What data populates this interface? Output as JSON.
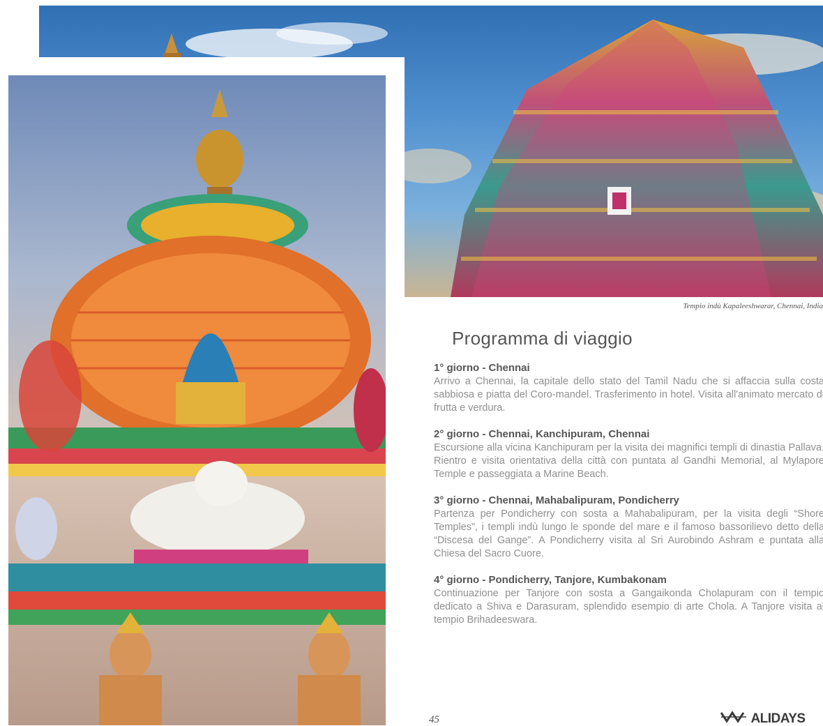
{
  "photo_back": {
    "subject": "Kapaleeshwarar temple gopuram against blue sky"
  },
  "photo_front": {
    "subject": "Colourful Hindu temple dome with Nandi bull and deity sculptures"
  },
  "caption": "Tempio indù  Kapaleeshwarar, Chennai, India",
  "program": {
    "title": "Programma di viaggio",
    "days": [
      {
        "title": "1° giorno - Chennai",
        "text": "Arrivo a Chennai, la capitale dello stato del Tamil Nadu che si affaccia sulla costa sabbiosa e piatta del Coro-mandel. Trasferimento in hotel. Visita all'animato mercato di frutta e verdura."
      },
      {
        "title": "2° giorno - Chennai, Kanchipuram, Chennai",
        "text": "Escursione alla vicina Kanchipuram per la visita dei magnifici templi di dinastia Pallava. Rientro e visita orientativa della città con puntata al Gandhi Memorial, al Mylapore Temple e passeggiata a Marine Beach."
      },
      {
        "title": "3° giorno - Chennai, Mahabalipuram, Pondicherry",
        "text": "Partenza per Pondicherry con sosta a Mahabalipuram, per la visita degli “Shore Temples”, i templi indù lungo le sponde del mare e il famoso bassorilievo detto della “Discesa del Gange”. A Pondicherry visita al Sri Aurobindo Ashram e puntata alla Chiesa del Sacro Cuore."
      },
      {
        "title": "4° giorno - Pondicherry, Tanjore, Kumbakonam",
        "text": "Continuazione per Tanjore con sosta a Gangaikonda Cholapuram con il tempio dedicato a Shiva e Darasuram, splendido esempio di arte Chola. A Tanjore visita al tempio Brihadeeswara."
      }
    ]
  },
  "footer": {
    "page_number": "45",
    "logo_text": "ALIDAYS",
    "logo_icon": "alidays-logo-icon"
  }
}
